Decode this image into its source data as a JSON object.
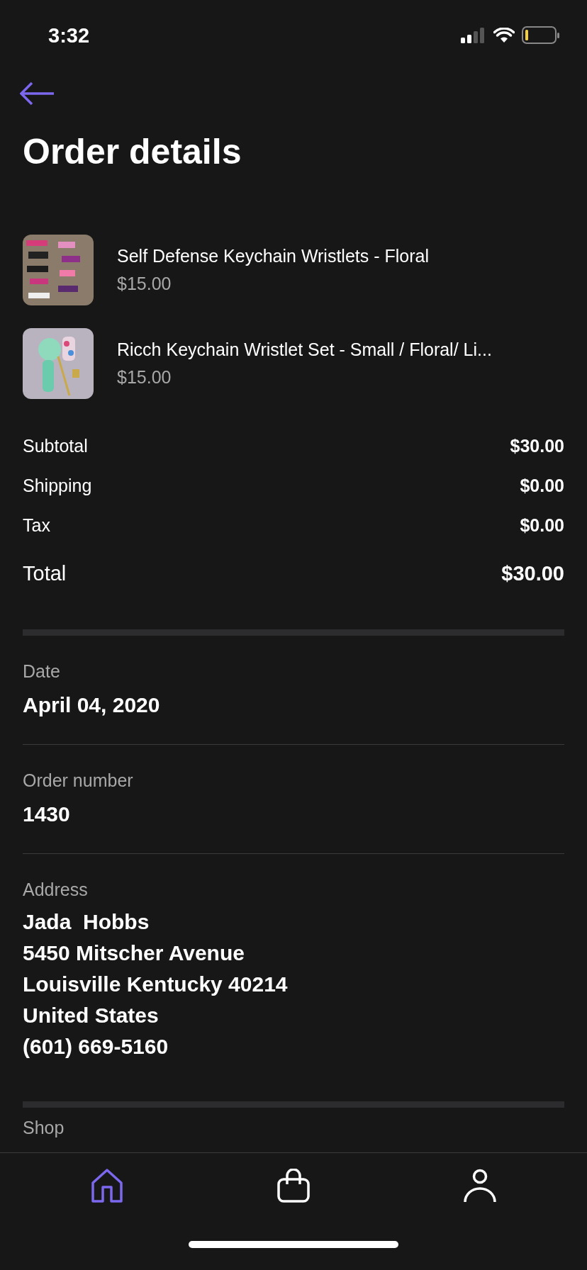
{
  "status_bar": {
    "time": "3:32"
  },
  "title": "Order details",
  "items": [
    {
      "name": "Self Defense Keychain Wristlets - Floral",
      "price": "$15.00",
      "kind": "picture"
    },
    {
      "name": "Ricch Keychain Wristlet Set - Small / Floral/ Li...",
      "price": "$15.00",
      "kind": "picture"
    }
  ],
  "summary": [
    {
      "label": "Subtotal",
      "value": "$30.00",
      "kind": "line"
    },
    {
      "label": "Shipping",
      "value": "$0.00",
      "kind": "line"
    },
    {
      "label": "Tax",
      "value": "$0.00",
      "kind": "line"
    },
    {
      "label": "Total",
      "value": "$30.00",
      "kind": "total"
    }
  ],
  "date": {
    "label": "Date",
    "value": "April 04, 2020"
  },
  "order_number": {
    "label": "Order number",
    "value": "1430"
  },
  "address": {
    "label": "Address",
    "lines": [
      "Jada  Hobbs",
      "5450 Mitscher Avenue",
      "Louisville Kentucky 40214",
      "United States",
      "(601) 669-5160"
    ]
  },
  "shop": {
    "label": "Shop"
  },
  "tab_bar": [
    {
      "kind": "home",
      "selected": true
    },
    {
      "kind": "bag",
      "selected": false
    },
    {
      "kind": "profile",
      "selected": false
    }
  ]
}
